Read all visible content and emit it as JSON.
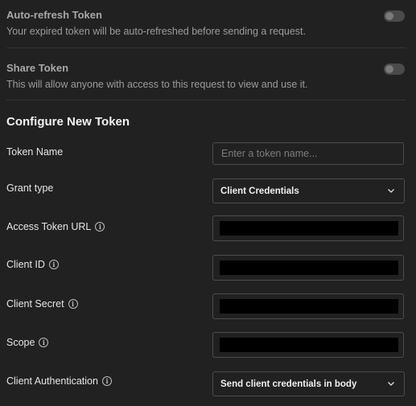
{
  "auto_refresh": {
    "title": "Auto-refresh Token",
    "description": "Your expired token will be auto-refreshed before sending a request.",
    "enabled": false
  },
  "share_token": {
    "title": "Share Token",
    "description": "This will allow anyone with access to this request to view and use it.",
    "enabled": false
  },
  "configure": {
    "title": "Configure New Token",
    "token_name": {
      "label": "Token Name",
      "value": "",
      "placeholder": "Enter a token name..."
    },
    "grant_type": {
      "label": "Grant type",
      "value": "Client Credentials"
    },
    "access_token_url": {
      "label": "Access Token URL"
    },
    "client_id": {
      "label": "Client ID"
    },
    "client_secret": {
      "label": "Client Secret"
    },
    "scope": {
      "label": "Scope"
    },
    "client_authentication": {
      "label": "Client Authentication",
      "value": "Send client credentials in body"
    }
  },
  "icons": {
    "info": "info-icon",
    "chevron": "chevron-down-icon"
  }
}
